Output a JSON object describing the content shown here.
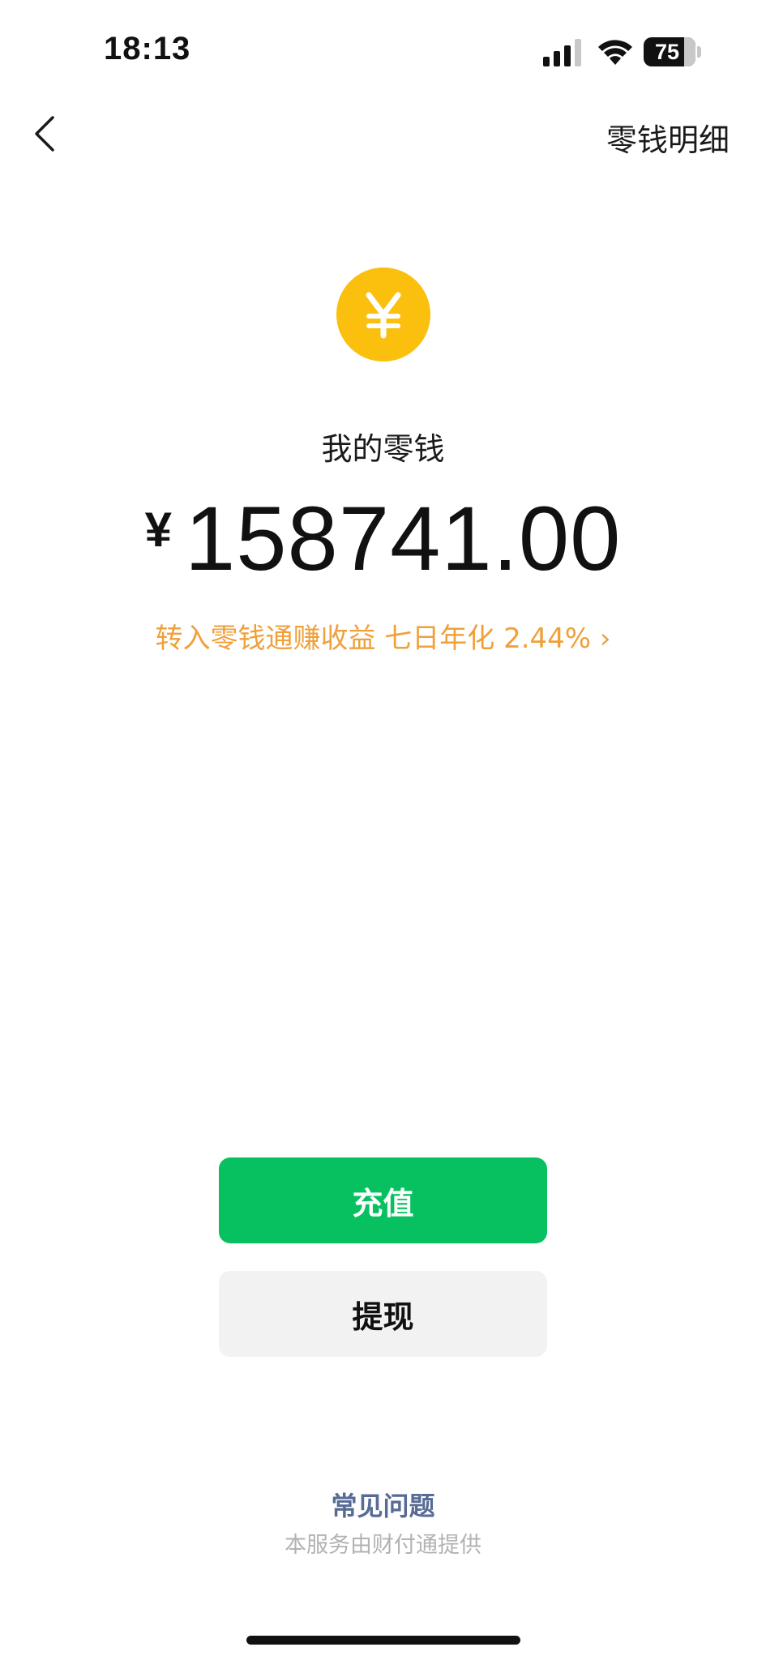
{
  "status_bar": {
    "time": "18:13",
    "battery": "75",
    "signal_icon": "cellular-signal-icon",
    "wifi_icon": "wifi-icon"
  },
  "nav": {
    "back_icon": "chevron-left-icon",
    "detail_link": "零钱明细"
  },
  "balance": {
    "icon": "yuan-coin-icon",
    "coin_color": "#fac00d",
    "title": "我的零钱",
    "currency_symbol": "¥",
    "amount": "158741.00"
  },
  "promo": {
    "text": "转入零钱通赚收益 七日年化 2.44% ›",
    "color": "#f0a03a"
  },
  "actions": {
    "recharge_label": "充值",
    "recharge_color": "#07c160",
    "withdraw_label": "提现"
  },
  "footer": {
    "faq_label": "常见问题",
    "provider_text": "本服务由财付通提供"
  }
}
